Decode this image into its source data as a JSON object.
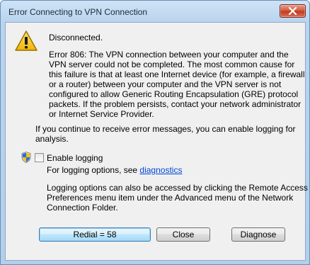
{
  "window": {
    "title": "Error Connecting to VPN Connection",
    "close_icon": "close-icon"
  },
  "icons": {
    "warning": "warning-icon",
    "shield": "shield-icon"
  },
  "message": {
    "status": "Disconnected.",
    "error_lines": [
      "Error 806: The VPN connection between your computer and the",
      "VPN server could not be completed. The most common cause for",
      "this failure is that at least one Internet device (for example, a firewall",
      "or a router) between your computer and the VPN server is not",
      "configured to allow Generic Routing Encapsulation (GRE) protocol",
      "packets. If the problem persists, contact your network administrator",
      "or Internet Service Provider."
    ],
    "logging_hint_lines": [
      "If you continue to receive error messages, you can enable logging for",
      "analysis."
    ]
  },
  "logging": {
    "checkbox_label": "Enable logging",
    "checked": false,
    "options_prefix": "For logging options, see ",
    "options_link": "diagnostics",
    "note_lines": [
      "Logging options can also be accessed by clicking the Remote Access",
      "Preferences menu item under the Advanced menu of the Network",
      "Connection Folder."
    ]
  },
  "buttons": {
    "redial": "Redial = 58",
    "close": "Close",
    "diagnose": "Diagnose"
  }
}
